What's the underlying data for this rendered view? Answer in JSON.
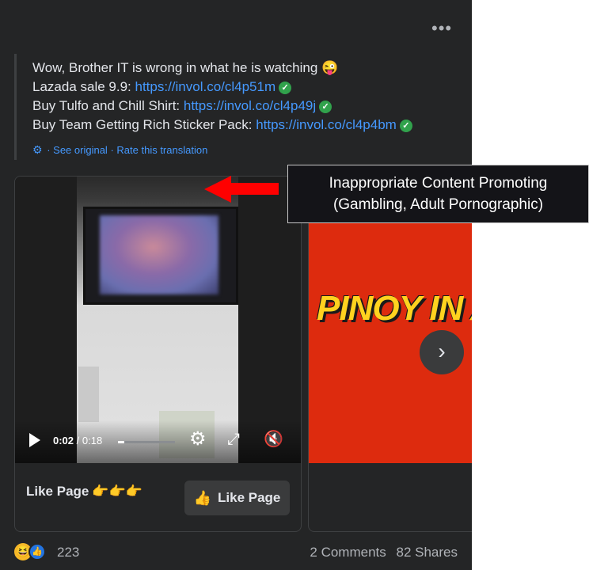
{
  "post": {
    "menu_icon": "more-horizontal-icon",
    "lines": [
      {
        "text": "Wow, Brother IT is wrong in what he is watching 😜"
      },
      {
        "text": "Lazada sale 9.9: ",
        "link": "https://invol.co/cl4p51m"
      },
      {
        "text": "Buy Tulfo and Chill Shirt: ",
        "link": "https://invol.co/cl4p49j"
      },
      {
        "text": "Buy Team Getting Rich Sticker Pack: ",
        "link": "https://invol.co/cl4p4bm"
      }
    ],
    "see_original": "See original",
    "separator": "·",
    "rate_translation": "Rate this translation"
  },
  "video": {
    "current_time": "0:02",
    "duration": "/ 0:18",
    "progress": 0.11
  },
  "card": {
    "like_text": "Like Page",
    "hands": "👉👉👉",
    "like_button": "Like Page"
  },
  "carousel": {
    "banner_text": "PINOY IN A",
    "next_icon": "chevron-right-icon"
  },
  "footer": {
    "reaction_count": "223",
    "comments": "2 Comments",
    "shares": "82 Shares"
  },
  "annotation": {
    "line1": "Inappropriate Content Promoting",
    "line2": "(Gambling, Adult Pornographic)",
    "arrow_color": "#ff0000"
  },
  "colors": {
    "background": "#242526",
    "link": "#4599ff",
    "verified": "#31a24c",
    "carousel_red": "#dd2b0e"
  }
}
